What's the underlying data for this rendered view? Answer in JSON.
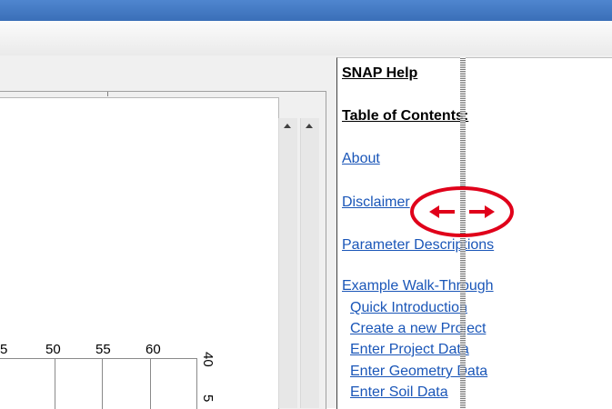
{
  "chart": {
    "xticks": [
      "5",
      "50",
      "55",
      "60"
    ],
    "yticks": [
      "40",
      "5"
    ]
  },
  "help": {
    "title": "SNAP Help",
    "toc_heading": "Table of Contents:",
    "links": [
      {
        "label": "About"
      },
      {
        "label": "Disclaimer"
      },
      {
        "label": "Parameter Descriptions"
      },
      {
        "label": "Example Walk-Through"
      }
    ],
    "sublinks": [
      {
        "label": "Quick Introduction"
      },
      {
        "label": "Create a new Project"
      },
      {
        "label": "Enter Project Data"
      },
      {
        "label": "Enter Geometry Data"
      },
      {
        "label": "Enter Soil Data"
      }
    ]
  },
  "annotation": {
    "color": "#e0001a",
    "meaning": "resize-splitter"
  }
}
